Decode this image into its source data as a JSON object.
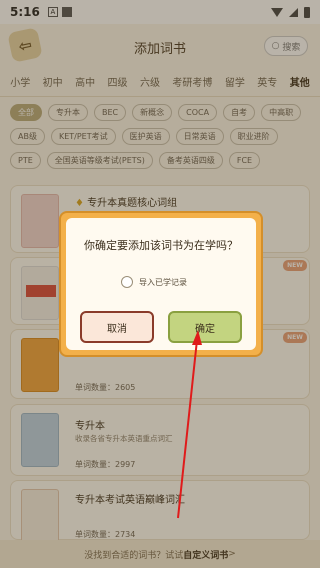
{
  "status_bar": {
    "time": "5:16",
    "notif_a": "A"
  },
  "header": {
    "title": "添加词书",
    "search_label": "搜索"
  },
  "categories": [
    "小学",
    "初中",
    "高中",
    "四级",
    "六级",
    "考研考博",
    "留学",
    "英专",
    "其他"
  ],
  "tags": [
    {
      "label": "全部",
      "active": true
    },
    {
      "label": "专升本",
      "active": false
    },
    {
      "label": "BEC",
      "active": false
    },
    {
      "label": "新概念",
      "active": false
    },
    {
      "label": "COCA",
      "active": false
    },
    {
      "label": "自考",
      "active": false
    },
    {
      "label": "中高职",
      "active": false
    },
    {
      "label": "AB级",
      "active": false
    },
    {
      "label": "KET/PET考试",
      "active": false
    },
    {
      "label": "医护英语",
      "active": false
    },
    {
      "label": "日常英语",
      "active": false
    },
    {
      "label": "职业进阶",
      "active": false
    },
    {
      "label": "PTE",
      "active": false
    },
    {
      "label": "全国英语等级考试(PETS)",
      "active": false
    },
    {
      "label": "备考英语四级",
      "active": false
    },
    {
      "label": "FCE",
      "active": false
    }
  ],
  "books": [
    {
      "title": "专升本真题核心词组",
      "desc": "",
      "count": "",
      "new": false
    },
    {
      "title": "",
      "desc": "",
      "count": "",
      "new": true
    },
    {
      "title": "",
      "desc": "",
      "count": "单词数量：2605",
      "new": true
    },
    {
      "title": "专升本",
      "desc": "收录各省专升本英语重点词汇",
      "count": "单词数量：2997",
      "new": false
    },
    {
      "title": "专升本考试英语巅峰词汇",
      "desc": "",
      "count": "单词数量：2734",
      "new": false
    }
  ],
  "new_badge": "NEW",
  "bottom_bar": {
    "prefix": "没找到合适的词书？试试",
    "link": "自定义词书",
    "suffix": ">"
  },
  "dialog": {
    "question": "你确定要添加该词书为在学吗？",
    "import_label": "导入已学记录",
    "import_checked": false,
    "cancel_label": "取消",
    "confirm_label": "确定"
  }
}
